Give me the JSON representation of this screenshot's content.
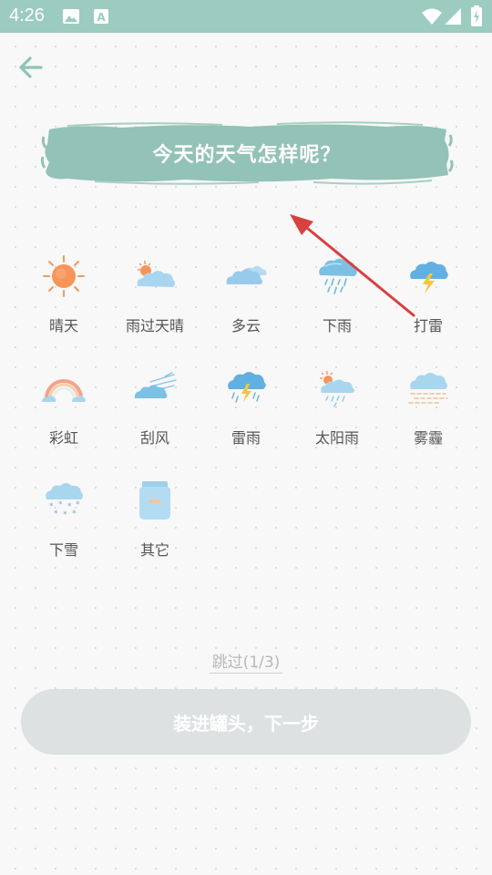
{
  "status_bar": {
    "time": "4:26"
  },
  "header": {
    "title": "今天的天气怎样呢？"
  },
  "weather_options": [
    {
      "label": "晴天",
      "icon": "sunny-icon"
    },
    {
      "label": "雨过天晴",
      "icon": "sun-behind-cloud-icon"
    },
    {
      "label": "多云",
      "icon": "cloudy-icon"
    },
    {
      "label": "下雨",
      "icon": "rain-icon"
    },
    {
      "label": "打雷",
      "icon": "thunder-icon"
    },
    {
      "label": "彩虹",
      "icon": "rainbow-icon"
    },
    {
      "label": "刮风",
      "icon": "wind-icon"
    },
    {
      "label": "雷雨",
      "icon": "thunderstorm-icon"
    },
    {
      "label": "太阳雨",
      "icon": "sun-rain-icon"
    },
    {
      "label": "雾霾",
      "icon": "fog-icon"
    },
    {
      "label": "下雪",
      "icon": "snow-icon"
    },
    {
      "label": "其它",
      "icon": "jar-icon"
    }
  ],
  "footer": {
    "skip_label": "跳过(1/3)",
    "next_label": "装进罐头，下一步"
  },
  "colors": {
    "accent": "#9ccbbf",
    "button_disabled": "#dde1e2",
    "annotation_arrow": "#d94040"
  }
}
